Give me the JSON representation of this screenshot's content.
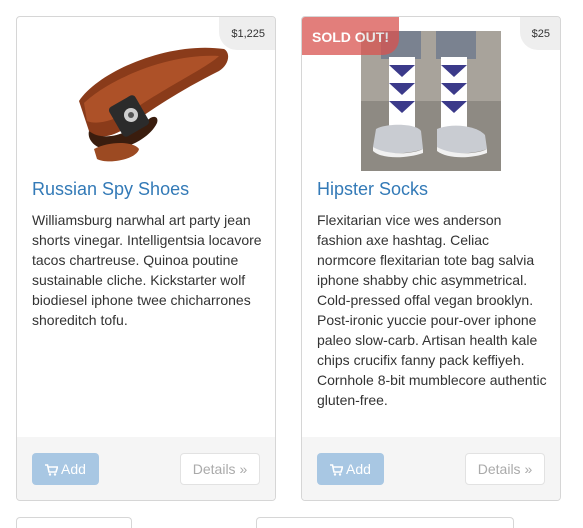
{
  "products": [
    {
      "price": "$1,225",
      "title": "Russian Spy Shoes",
      "description": "Williamsburg narwhal art party jean shorts vinegar. Intelligentsia locavore tacos chartreuse. Quinoa poutine sustainable cliche. Kickstarter wolf biodiesel iphone twee chicharrones shoreditch tofu.",
      "add_label": "Add",
      "details_label": "Details »",
      "sold_out": ""
    },
    {
      "price": "$25",
      "title": "Hipster Socks",
      "description": "Flexitarian vice wes anderson fashion axe hashtag. Celiac normcore flexitarian tote bag salvia iphone shabby chic asymmetrical. Cold-pressed offal vegan brooklyn. Post-ironic yuccie pour-over iphone paleo slow-carb. Artisan health kale chips crucifix fanny pack keffiyeh. Cornhole 8-bit mumblecore authentic gluten-free.",
      "add_label": "Add",
      "details_label": "Details »",
      "sold_out": "SOLD OUT!"
    }
  ],
  "icons": {
    "add": "shopping-cart-icon"
  },
  "colors": {
    "link": "#337ab7",
    "add_button": "#a8c7e3",
    "sold_out": "#d9534f",
    "price_tag": "#eeeeee"
  }
}
